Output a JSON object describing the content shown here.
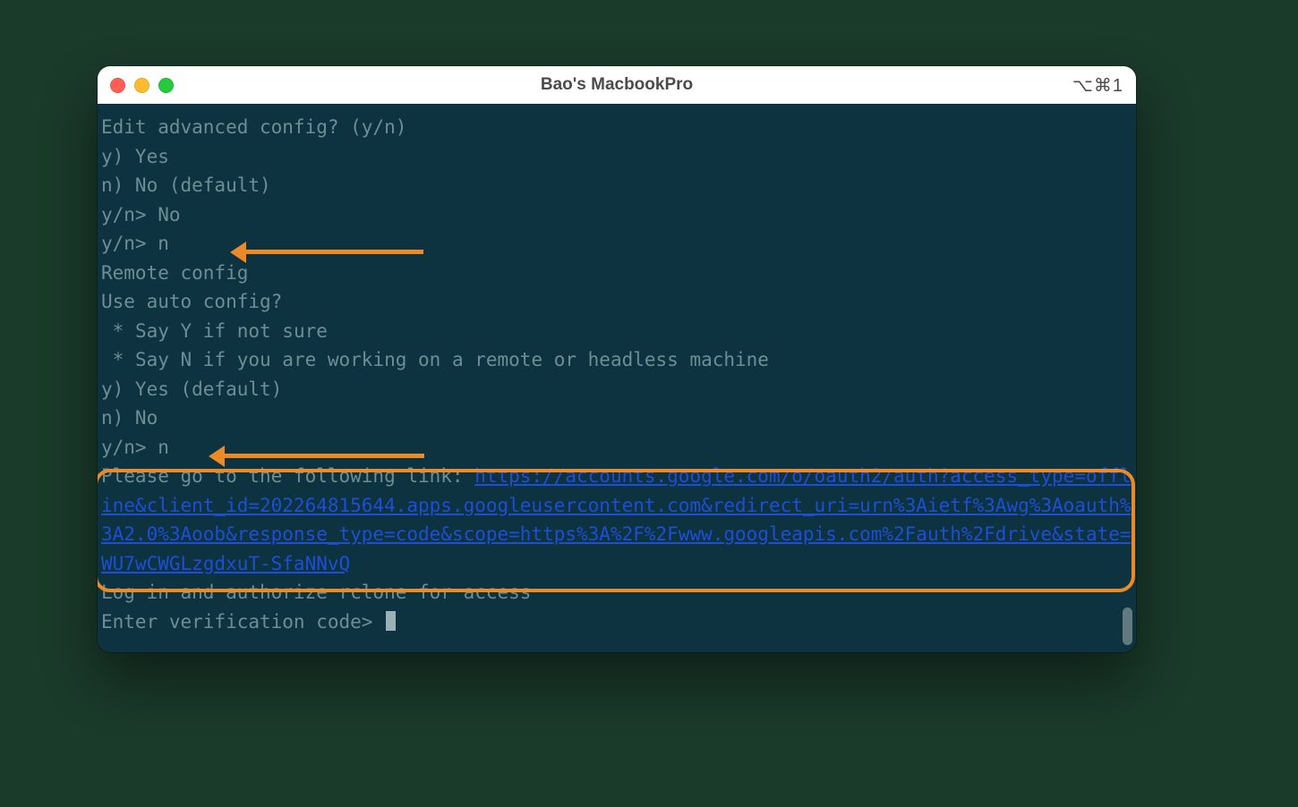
{
  "window": {
    "title": "Bao's MacbookPro",
    "shortcut_hint": "⌥⌘1"
  },
  "terminal": {
    "lines": [
      "Edit advanced config? (y/n)",
      "y) Yes",
      "n) No (default)",
      "y/n> No",
      "y/n> n",
      "Remote config",
      "Use auto config?",
      " * Say Y if not sure",
      " * Say N if you are working on a remote or headless machine",
      "y) Yes (default)",
      "n) No",
      "y/n> n"
    ],
    "link_prefix": "Please go to the following link: ",
    "oauth_url": "https://accounts.google.com/o/oauth2/auth?access_type=offline&client_id=202264815644.apps.googleusercontent.com&redirect_uri=urn%3Aietf%3Awg%3Aoauth%3A2.0%3Aoob&response_type=code&scope=https%3A%2F%2Fwww.googleapis.com%2Fauth%2Fdrive&state=WU7wCWGLzgdxuT-SfaNNvQ",
    "post_lines": [
      "Log in and authorize rclone for access",
      "Enter verification code> "
    ]
  }
}
